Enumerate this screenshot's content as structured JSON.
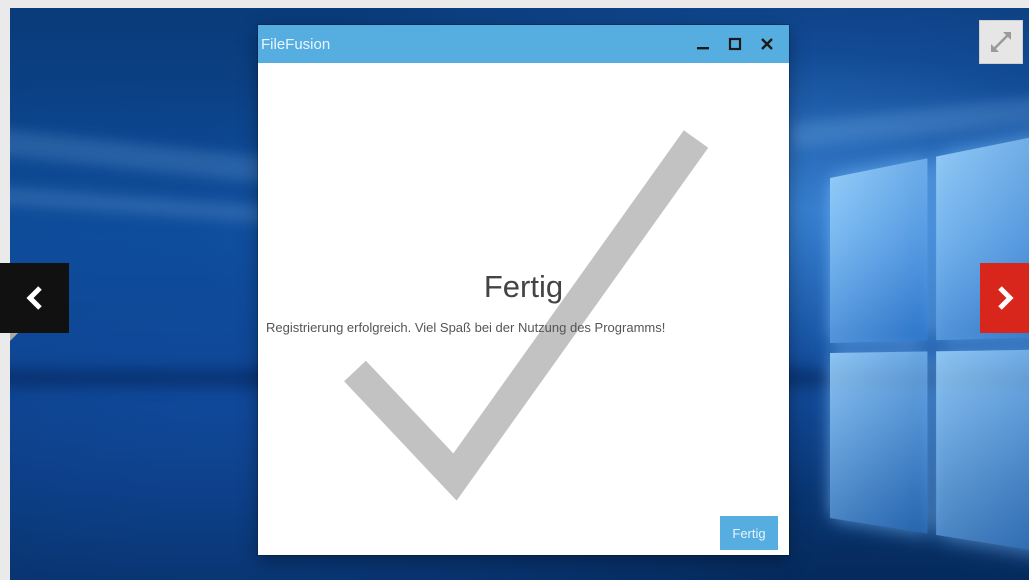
{
  "dialog": {
    "title": "FileFusion",
    "heading": "Fertig",
    "message": "Registrierung erfolgreich. Viel Spaß bei der Nutzung des Programms!",
    "finish_label": "Fertig"
  },
  "titlebar_icons": [
    "minimize-icon",
    "maximize-icon",
    "close-icon"
  ],
  "colors": {
    "accent": "#56aee0",
    "checkmark": "#c2c2c2",
    "next_arrow_bg": "#d8261c",
    "prev_arrow_bg": "#111111"
  },
  "gallery_icons": [
    "chevron-left-icon",
    "chevron-right-icon",
    "expand-icon"
  ]
}
